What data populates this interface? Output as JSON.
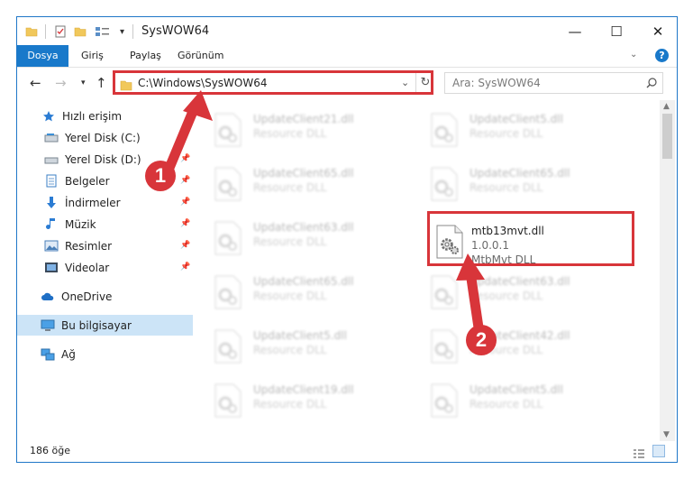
{
  "window": {
    "title": "SysWOW64",
    "controls": {
      "minimize": "—",
      "maximize": "☐",
      "close": "✕"
    }
  },
  "ribbon": {
    "tabs": [
      "Dosya",
      "Giriş",
      "Paylaş",
      "Görünüm"
    ],
    "help": "?"
  },
  "nav": {
    "address": "C:\\Windows\\SysWOW64",
    "search_placeholder": "Ara: SysWOW64"
  },
  "sidebar": {
    "items": [
      {
        "label": "Hızlı erişim",
        "icon": "star-icon"
      },
      {
        "label": "Yerel Disk (C:)",
        "icon": "drive-icon"
      },
      {
        "label": "Yerel Disk (D:)",
        "icon": "drive-icon"
      },
      {
        "label": "Belgeler",
        "icon": "documents-icon"
      },
      {
        "label": "İndirmeler",
        "icon": "download-icon"
      },
      {
        "label": "Müzik",
        "icon": "music-icon"
      },
      {
        "label": "Resimler",
        "icon": "pictures-icon"
      },
      {
        "label": "Videolar",
        "icon": "video-icon"
      },
      {
        "label": "OneDrive",
        "icon": "cloud-icon"
      },
      {
        "label": "Bu bilgisayar",
        "icon": "computer-icon"
      },
      {
        "label": "Ağ",
        "icon": "network-icon"
      }
    ]
  },
  "files": {
    "left_column": [
      {
        "name": "UpdateClient21.dll",
        "sub": "Resource DLL"
      },
      {
        "name": "UpdateClient65.dll",
        "sub": "Resource DLL"
      },
      {
        "name": "UpdateClient63.dll",
        "sub": "Resource DLL"
      },
      {
        "name": "UpdateClient65.dll",
        "sub": "Resource DLL"
      },
      {
        "name": "UpdateClient5.dll",
        "sub": "Resource DLL"
      },
      {
        "name": "UpdateClient19.dll",
        "sub": "Resource DLL"
      }
    ],
    "right_column": [
      {
        "name": "UpdateClient5.dll",
        "sub": "Resource DLL"
      },
      {
        "name": "UpdateClient65.dll",
        "sub": "Resource DLL"
      },
      {
        "name": "UpdateClient63.dll",
        "sub": "Resource DLL"
      },
      {
        "name": "UpdateClient42.dll",
        "sub": "Resource DLL"
      },
      {
        "name": "UpdateClient5.dll",
        "sub": "Resource DLL"
      }
    ],
    "highlighted": {
      "name": "mtb13mvt.dll",
      "version": "1.0.0.1",
      "description": "MtbMvt DLL"
    }
  },
  "status": {
    "item_count": "186 öğe"
  },
  "callouts": [
    "1",
    "2"
  ],
  "colors": {
    "accent": "#1979ca",
    "highlight": "#d8353a",
    "selected": "#cce4f7"
  }
}
